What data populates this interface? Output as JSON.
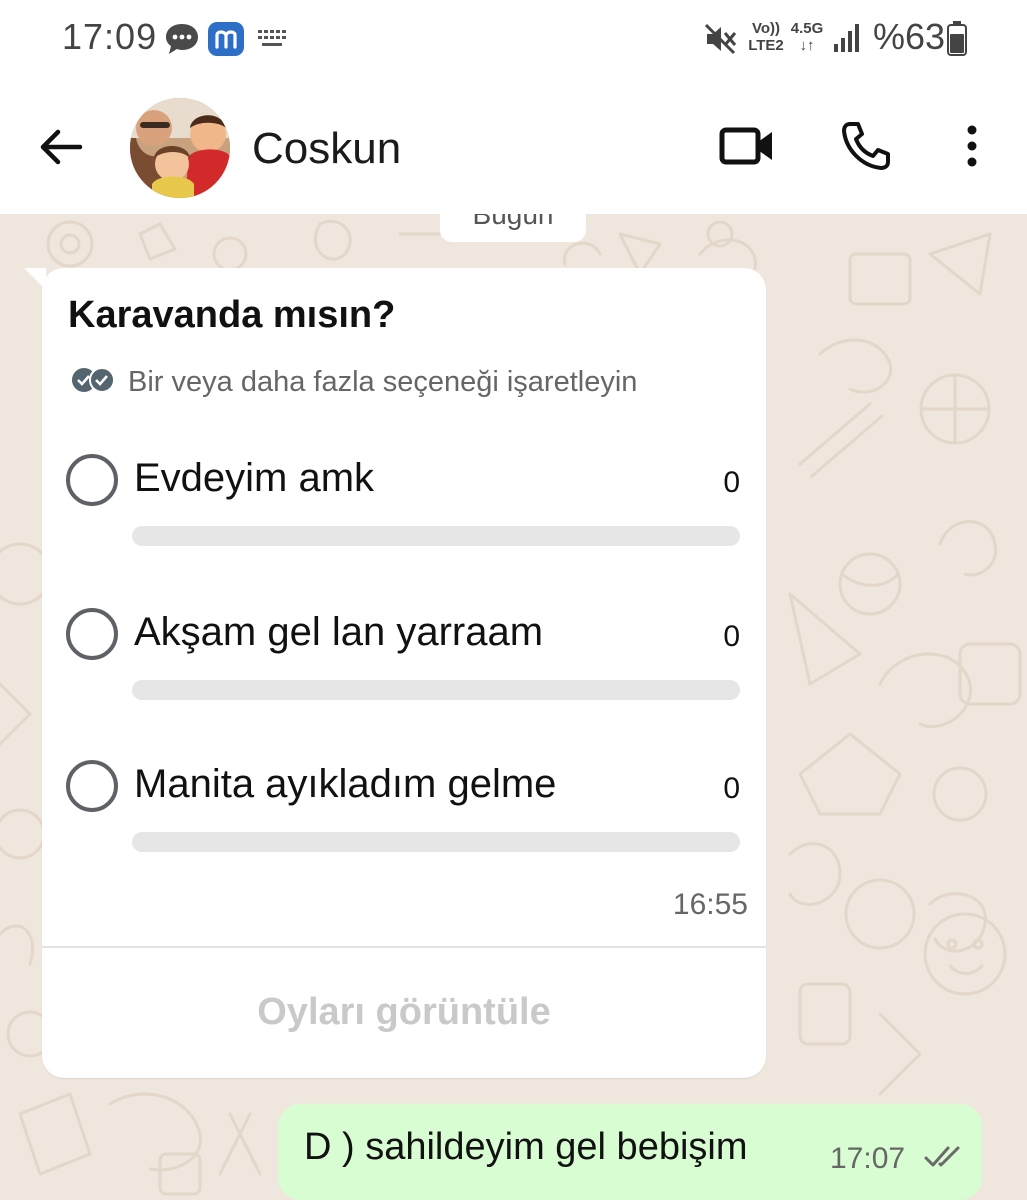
{
  "status_bar": {
    "time": "17:09",
    "net_volte": "Vo))",
    "net_lte": "LTE2",
    "net_gen": "4.5G",
    "battery": "%63",
    "icons": [
      "chat-bubble-icon",
      "app-m-icon",
      "keyboard-icon",
      "mute-icon",
      "signal-icon",
      "battery-icon"
    ]
  },
  "header": {
    "contact_name": "Coskun",
    "icons": [
      "back-arrow-icon",
      "video-call-icon",
      "phone-icon",
      "more-vert-icon"
    ]
  },
  "chat": {
    "date_chip": "Bugün",
    "poll": {
      "question": "Karavanda mısın?",
      "hint": "Bir veya daha fazla seçeneği işaretleyin",
      "options": [
        {
          "label": "Evdeyim amk",
          "count": "0",
          "fraction": 0
        },
        {
          "label": "Akşam gel lan yarraam",
          "count": "0",
          "fraction": 0
        },
        {
          "label": "Manita ayıkladım gelme",
          "count": "0",
          "fraction": 0
        }
      ],
      "time": "16:55",
      "view_votes": "Oyları görüntüle"
    },
    "outgoing": {
      "text": "D ) sahildeyim gel bebişim",
      "time": "17:07",
      "status": "delivered"
    }
  },
  "colors": {
    "chat_bg": "#efe7dd",
    "outgoing_bubble": "#d9fdd3",
    "radio_border": "#5e6266",
    "bar_track": "#e6e6e6"
  }
}
